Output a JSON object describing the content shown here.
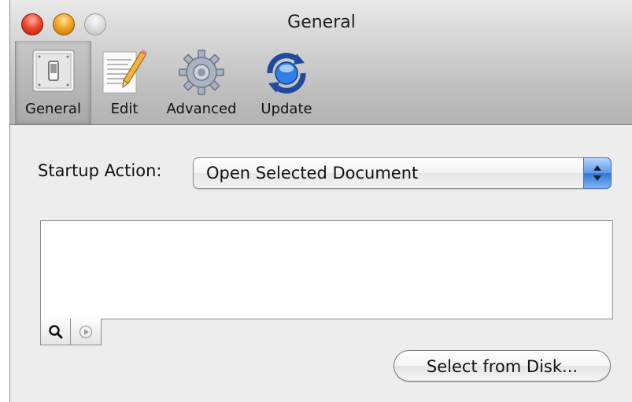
{
  "window": {
    "title": "General"
  },
  "toolbar": {
    "items": [
      {
        "label": "General",
        "icon": "switch-icon",
        "selected": true
      },
      {
        "label": "Edit",
        "icon": "notepad-pencil-icon"
      },
      {
        "label": "Advanced",
        "icon": "gear-icon"
      },
      {
        "label": "Update",
        "icon": "sync-globe-icon"
      }
    ]
  },
  "general": {
    "startup_label": "Startup Action:",
    "startup_value": "Open Selected Document",
    "select_button": "Select from Disk..."
  },
  "colors": {
    "accent": "#3a7fdc",
    "close": "#f0482e",
    "minimize": "#f5a623"
  }
}
